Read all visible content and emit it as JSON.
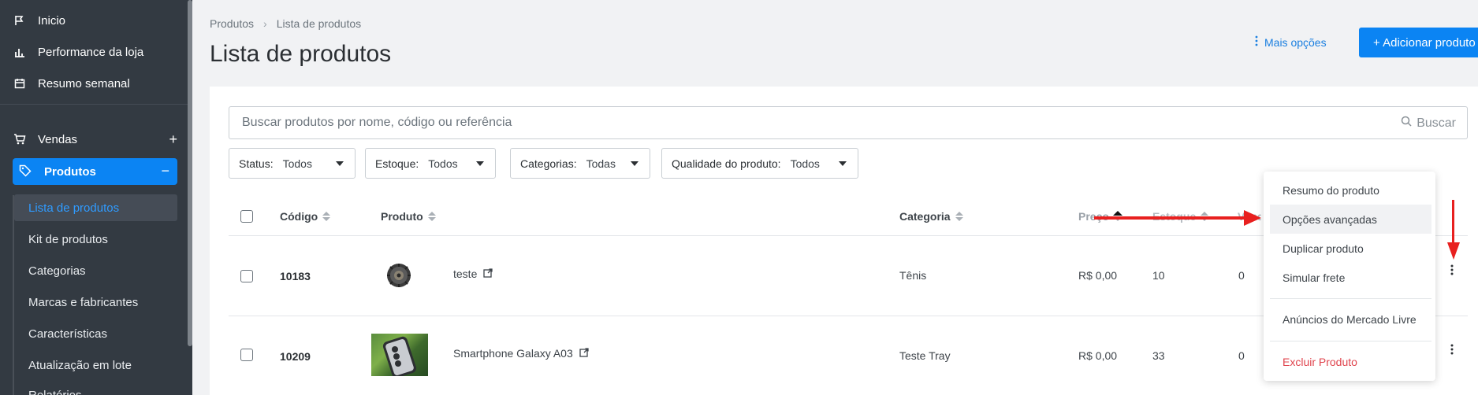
{
  "colors": {
    "sidebar_bg": "#333a42",
    "accent": "#0b84f3",
    "danger": "#e0454e",
    "annotation": "#e8201f"
  },
  "sidebar": {
    "items": [
      {
        "label": "Inicio",
        "icon": "flag-icon"
      },
      {
        "label": "Performance da loja",
        "icon": "bar-chart-icon"
      },
      {
        "label": "Resumo semanal",
        "icon": "calendar-icon"
      }
    ],
    "sections": [
      {
        "label": "Vendas",
        "icon": "cart-icon",
        "toggle": "+"
      },
      {
        "label": "Produtos",
        "icon": "tag-icon",
        "toggle": "−"
      }
    ],
    "submenu": [
      {
        "label": "Lista de produtos",
        "active": true
      },
      {
        "label": "Kit de produtos"
      },
      {
        "label": "Categorias"
      },
      {
        "label": "Marcas e fabricantes"
      },
      {
        "label": "Características"
      },
      {
        "label": "Atualização em lote"
      },
      {
        "label": "Relatórios"
      }
    ]
  },
  "breadcrumb": {
    "parent": "Produtos",
    "separator": "›",
    "current": "Lista de produtos"
  },
  "page": {
    "title": "Lista de produtos"
  },
  "header_actions": {
    "more_options": "Mais opções",
    "add_product": "+ Adicionar produto"
  },
  "search": {
    "placeholder": "Buscar produtos por nome, código ou referência",
    "button": "Buscar"
  },
  "filters": [
    {
      "label": "Status:",
      "value": "Todos"
    },
    {
      "label": "Estoque:",
      "value": "Todos"
    },
    {
      "label": "Categorias:",
      "value": "Todas"
    },
    {
      "label": "Qualidade do produto:",
      "value": "Todos"
    }
  ],
  "table": {
    "columns": [
      "Código",
      "Produto",
      "Categoria",
      "Preço",
      "Estoque",
      "Vendas"
    ],
    "rows": [
      {
        "code": "10183",
        "name": "teste",
        "category": "Tênis",
        "price": "R$ 0,00",
        "stock": "10",
        "sales": "0"
      },
      {
        "code": "10209",
        "name": "Smartphone Galaxy A03",
        "category": "Teste Tray",
        "price": "R$ 0,00",
        "stock": "33",
        "sales": "0"
      }
    ]
  },
  "row_menu": {
    "items": [
      "Resumo do produto",
      "Opções avançadas",
      "Duplicar produto",
      "Simular frete",
      "Anúncios do Mercado Livre",
      "Excluir Produto"
    ]
  }
}
